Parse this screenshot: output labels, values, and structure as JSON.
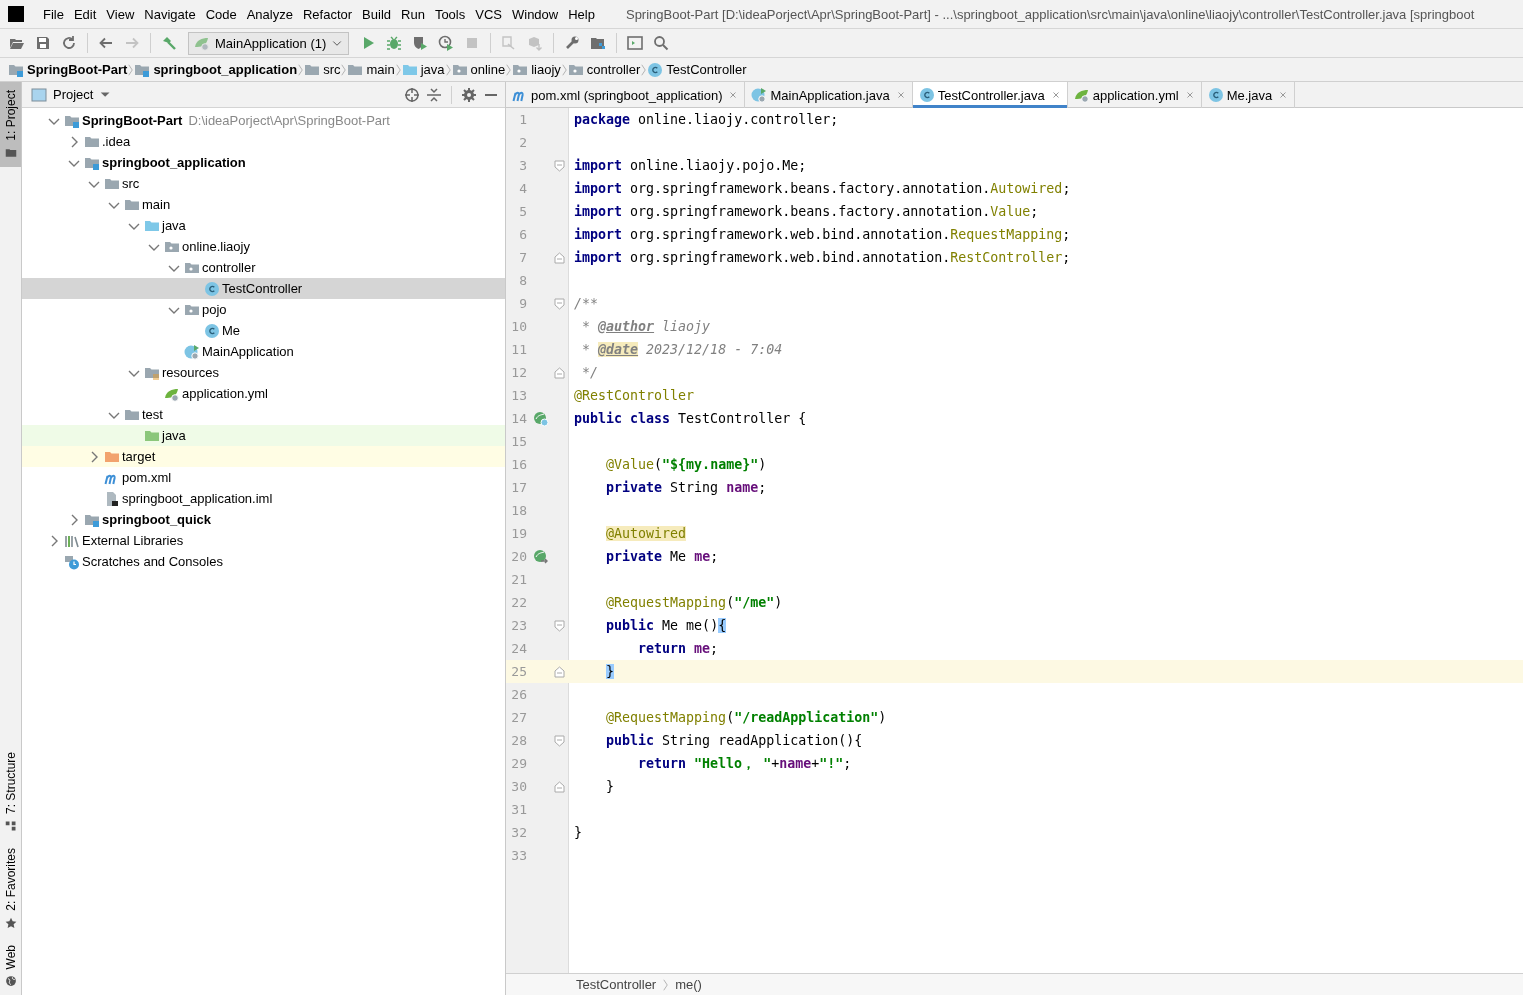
{
  "menu": [
    {
      "label": "File"
    },
    {
      "label": "Edit"
    },
    {
      "label": "View"
    },
    {
      "label": "Navigate"
    },
    {
      "label": "Code"
    },
    {
      "label": "Analyze"
    },
    {
      "label": "Refactor"
    },
    {
      "label": "Build"
    },
    {
      "label": "Run"
    },
    {
      "label": "Tools"
    },
    {
      "label": "VCS"
    },
    {
      "label": "Window"
    },
    {
      "label": "Help"
    }
  ],
  "window": {
    "title": "SpringBoot-Part [D:\\ideaPorject\\Apr\\SpringBoot-Part] - ...\\springboot_application\\src\\main\\java\\online\\liaojy\\controller\\TestController.java [springboot"
  },
  "toolbar": [
    {
      "kind": "open",
      "disabled": false
    },
    {
      "kind": "save",
      "disabled": false
    },
    {
      "kind": "sync",
      "disabled": false
    },
    {
      "kind": "separator"
    },
    {
      "kind": "back",
      "disabled": false
    },
    {
      "kind": "forward",
      "disabled": true
    },
    {
      "kind": "separator"
    },
    {
      "kind": "build",
      "disabled": false
    },
    {
      "kind": "run-config",
      "label": "MainApplication (1)"
    },
    {
      "kind": "run",
      "disabled": false
    },
    {
      "kind": "debug",
      "disabled": false
    },
    {
      "kind": "coverage",
      "disabled": false
    },
    {
      "kind": "profile",
      "disabled": false
    },
    {
      "kind": "stop",
      "disabled": true
    },
    {
      "kind": "separator"
    },
    {
      "kind": "attach",
      "disabled": true
    },
    {
      "kind": "update",
      "disabled": true
    },
    {
      "kind": "separator"
    },
    {
      "kind": "wrench",
      "disabled": false
    },
    {
      "kind": "structure",
      "disabled": false
    },
    {
      "kind": "separator"
    },
    {
      "kind": "terminal",
      "disabled": false
    },
    {
      "kind": "search",
      "disabled": false
    }
  ],
  "breadcrumbs": [
    {
      "label": "SpringBoot-Part",
      "kind": "module"
    },
    {
      "label": "springboot_application",
      "kind": "module"
    },
    {
      "label": "src",
      "kind": "folder"
    },
    {
      "label": "main",
      "kind": "folder"
    },
    {
      "label": "java",
      "kind": "source"
    },
    {
      "label": "online",
      "kind": "package"
    },
    {
      "label": "liaojy",
      "kind": "package"
    },
    {
      "label": "controller",
      "kind": "package"
    },
    {
      "label": "TestController",
      "kind": "class"
    }
  ],
  "tool_windows": {
    "top": [
      {
        "label": "1: Project",
        "kind": "project",
        "selected": true
      }
    ],
    "bottom": [
      {
        "label": "7: Structure",
        "kind": "structure",
        "selected": false
      },
      {
        "label": "2: Favorites",
        "kind": "favorites",
        "selected": false
      },
      {
        "label": "Web",
        "kind": "web",
        "selected": false
      }
    ]
  },
  "project": {
    "title": "Project",
    "tree": [
      {
        "label": "SpringBoot-Part",
        "kind": "module",
        "path": "D:\\ideaPorject\\Apr\\SpringBoot-Part",
        "expanded": true,
        "selected": false,
        "children": [
          {
            "label": ".idea",
            "kind": "folder",
            "expanded": false,
            "selected": false
          },
          {
            "label": "springboot_application",
            "kind": "module",
            "expanded": true,
            "selected": false,
            "children": [
              {
                "label": "src",
                "kind": "folder",
                "expanded": true,
                "selected": false,
                "children": [
                  {
                    "label": "main",
                    "kind": "folder",
                    "expanded": true,
                    "selected": false,
                    "children": [
                      {
                        "label": "java",
                        "kind": "source",
                        "expanded": true,
                        "selected": false,
                        "children": [
                          {
                            "label": "online.liaojy",
                            "kind": "package",
                            "expanded": true,
                            "selected": false,
                            "children": [
                              {
                                "label": "controller",
                                "kind": "package",
                                "expanded": true,
                                "selected": false,
                                "children": [
                                  {
                                    "label": "TestController",
                                    "kind": "class",
                                    "selected": true
                                  }
                                ]
                              },
                              {
                                "label": "pojo",
                                "kind": "package",
                                "expanded": true,
                                "selected": false,
                                "children": [
                                  {
                                    "label": "Me",
                                    "kind": "class",
                                    "selected": false
                                  }
                                ]
                              },
                              {
                                "label": "MainApplication",
                                "kind": "spring-class",
                                "selected": false
                              }
                            ]
                          }
                        ]
                      },
                      {
                        "label": "resources",
                        "kind": "resources",
                        "expanded": true,
                        "selected": false,
                        "children": [
                          {
                            "label": "application.yml",
                            "kind": "spring-config",
                            "selected": false
                          }
                        ]
                      }
                    ]
                  },
                  {
                    "label": "test",
                    "kind": "folder",
                    "expanded": true,
                    "selected": false,
                    "children": [
                      {
                        "label": "java",
                        "kind": "test-source",
                        "selected": false
                      }
                    ]
                  }
                ]
              },
              {
                "label": "target",
                "kind": "excluded",
                "expanded": false,
                "selected": false
              },
              {
                "label": "pom.xml",
                "kind": "maven",
                "selected": false
              },
              {
                "label": "springboot_application.iml",
                "kind": "iml",
                "selected": false
              }
            ]
          },
          {
            "label": "springboot_quick",
            "kind": "module",
            "expanded": false,
            "selected": false
          }
        ]
      },
      {
        "label": "External Libraries",
        "kind": "libraries",
        "expanded": false,
        "selected": false
      },
      {
        "label": "Scratches and Consoles",
        "kind": "scratches",
        "selected": false
      }
    ]
  },
  "tabs": [
    {
      "label": "pom.xml (springboot_application)",
      "kind": "maven",
      "selected": false
    },
    {
      "label": "MainApplication.java",
      "kind": "spring-class",
      "selected": false
    },
    {
      "label": "TestController.java",
      "kind": "class",
      "selected": true
    },
    {
      "label": "application.yml",
      "kind": "spring-config",
      "selected": false
    },
    {
      "label": "Me.java",
      "kind": "class",
      "selected": false
    }
  ],
  "code": [
    {
      "n": "1",
      "current": false,
      "tokens": [
        {
          "text": "package",
          "kind": "kw"
        },
        {
          "text": " online.liaojy.controller;",
          "kind": "plain"
        }
      ]
    },
    {
      "n": "2",
      "current": false
    },
    {
      "n": "3",
      "current": false,
      "fold": {
        "kind": "start"
      },
      "tokens": [
        {
          "text": "import",
          "kind": "kw"
        },
        {
          "text": " online.liaojy.pojo.Me;",
          "kind": "plain"
        }
      ]
    },
    {
      "n": "4",
      "current": false,
      "tokens": [
        {
          "text": "import",
          "kind": "kw"
        },
        {
          "text": " org.springframework.beans.factory.annotation.",
          "kind": "plain"
        },
        {
          "text": "Autowired",
          "kind": "ann"
        },
        {
          "text": ";",
          "kind": "plain"
        }
      ]
    },
    {
      "n": "5",
      "current": false,
      "tokens": [
        {
          "text": "import",
          "kind": "kw"
        },
        {
          "text": " org.springframework.beans.factory.annotation.",
          "kind": "plain"
        },
        {
          "text": "Value",
          "kind": "ann"
        },
        {
          "text": ";",
          "kind": "plain"
        }
      ]
    },
    {
      "n": "6",
      "current": false,
      "tokens": [
        {
          "text": "import",
          "kind": "kw"
        },
        {
          "text": " org.springframework.web.bind.annotation.",
          "kind": "plain"
        },
        {
          "text": "RequestMapping",
          "kind": "ann"
        },
        {
          "text": ";",
          "kind": "plain"
        }
      ]
    },
    {
      "n": "7",
      "current": false,
      "fold": {
        "kind": "end"
      },
      "tokens": [
        {
          "text": "import",
          "kind": "kw"
        },
        {
          "text": " org.springframework.web.bind.annotation.",
          "kind": "plain"
        },
        {
          "text": "RestController",
          "kind": "ann"
        },
        {
          "text": ";",
          "kind": "plain"
        }
      ]
    },
    {
      "n": "8",
      "current": false
    },
    {
      "n": "9",
      "current": false,
      "fold": {
        "kind": "start"
      },
      "tokens": [
        {
          "text": "/**",
          "kind": "comment"
        }
      ]
    },
    {
      "n": "10",
      "current": false,
      "tokens": [
        {
          "text": " * ",
          "kind": "comment"
        },
        {
          "text": "@author",
          "kind": "doctag"
        },
        {
          "text": " liaojy",
          "kind": "comment"
        }
      ]
    },
    {
      "n": "11",
      "current": false,
      "tokens": [
        {
          "text": " * ",
          "kind": "comment"
        },
        {
          "text": "@date",
          "kind": "doctag-hl"
        },
        {
          "text": " 2023/12/18 - 7:04",
          "kind": "comment"
        }
      ]
    },
    {
      "n": "12",
      "current": false,
      "fold": {
        "kind": "end"
      },
      "tokens": [
        {
          "text": " */",
          "kind": "comment"
        }
      ]
    },
    {
      "n": "13",
      "current": false,
      "tokens": [
        {
          "text": "@RestController",
          "kind": "ann"
        }
      ]
    },
    {
      "n": "14",
      "current": false,
      "gutter": {
        "kind": "bean"
      },
      "tokens": [
        {
          "text": "public class",
          "kind": "kw"
        },
        {
          "text": " TestController {",
          "kind": "plain"
        }
      ]
    },
    {
      "n": "15",
      "current": false
    },
    {
      "n": "16",
      "current": false,
      "tokens": [
        {
          "text": "    @Value",
          "kind": "ann"
        },
        {
          "text": "(",
          "kind": "plain"
        },
        {
          "text": "\"${my.name}\"",
          "kind": "str"
        },
        {
          "text": ")",
          "kind": "plain"
        }
      ]
    },
    {
      "n": "17",
      "current": false,
      "tokens": [
        {
          "text": "    private",
          "kind": "kw"
        },
        {
          "text": " String ",
          "kind": "plain"
        },
        {
          "text": "name",
          "kind": "field"
        },
        {
          "text": ";",
          "kind": "plain"
        }
      ]
    },
    {
      "n": "18",
      "current": false
    },
    {
      "n": "19",
      "current": false,
      "tokens": [
        {
          "text": "    @Autowired",
          "kind": "ann-hl"
        }
      ]
    },
    {
      "n": "20",
      "current": false,
      "gutter": {
        "kind": "autowired"
      },
      "tokens": [
        {
          "text": "    private",
          "kind": "kw"
        },
        {
          "text": " Me ",
          "kind": "plain"
        },
        {
          "text": "me",
          "kind": "field"
        },
        {
          "text": ";",
          "kind": "plain"
        }
      ]
    },
    {
      "n": "21",
      "current": false
    },
    {
      "n": "22",
      "current": false,
      "tokens": [
        {
          "text": "    @RequestMapping",
          "kind": "ann"
        },
        {
          "text": "(",
          "kind": "plain"
        },
        {
          "text": "\"/me\"",
          "kind": "str"
        },
        {
          "text": ")",
          "kind": "plain"
        }
      ]
    },
    {
      "n": "23",
      "current": false,
      "fold": {
        "kind": "start"
      },
      "tokens": [
        {
          "text": "    public",
          "kind": "kw"
        },
        {
          "text": " Me me()",
          "kind": "plain"
        },
        {
          "text": "{",
          "kind": "match"
        }
      ]
    },
    {
      "n": "24",
      "current": false,
      "tokens": [
        {
          "text": "        return ",
          "kind": "kw"
        },
        {
          "text": "me",
          "kind": "field"
        },
        {
          "text": ";",
          "kind": "plain"
        }
      ]
    },
    {
      "n": "25",
      "current": true,
      "fold": {
        "kind": "end"
      },
      "tokens": [
        {
          "text": "    }",
          "kind": "match"
        }
      ]
    },
    {
      "n": "26",
      "current": false
    },
    {
      "n": "27",
      "current": false,
      "tokens": [
        {
          "text": "    @RequestMapping",
          "kind": "ann"
        },
        {
          "text": "(",
          "kind": "plain"
        },
        {
          "text": "\"/readApplication\"",
          "kind": "str"
        },
        {
          "text": ")",
          "kind": "plain"
        }
      ]
    },
    {
      "n": "28",
      "current": false,
      "fold": {
        "kind": "start"
      },
      "tokens": [
        {
          "text": "    public",
          "kind": "kw"
        },
        {
          "text": " String readApplication(){",
          "kind": "plain"
        }
      ]
    },
    {
      "n": "29",
      "current": false,
      "tokens": [
        {
          "text": "        return ",
          "kind": "kw"
        },
        {
          "text": "\"Hello， \"",
          "kind": "str"
        },
        {
          "text": "+",
          "kind": "plain"
        },
        {
          "text": "name",
          "kind": "field"
        },
        {
          "text": "+",
          "kind": "plain"
        },
        {
          "text": "\"!\"",
          "kind": "str"
        },
        {
          "text": ";",
          "kind": "plain"
        }
      ]
    },
    {
      "n": "30",
      "current": false,
      "fold": {
        "kind": "end"
      },
      "tokens": [
        {
          "text": "    }",
          "kind": "plain"
        }
      ]
    },
    {
      "n": "31",
      "current": false
    },
    {
      "n": "32",
      "current": false,
      "tokens": [
        {
          "text": "}",
          "kind": "plain"
        }
      ]
    },
    {
      "n": "33",
      "current": false
    }
  ],
  "editor_breadcrumbs": [
    {
      "label": "TestController"
    },
    {
      "label": "me()"
    }
  ]
}
